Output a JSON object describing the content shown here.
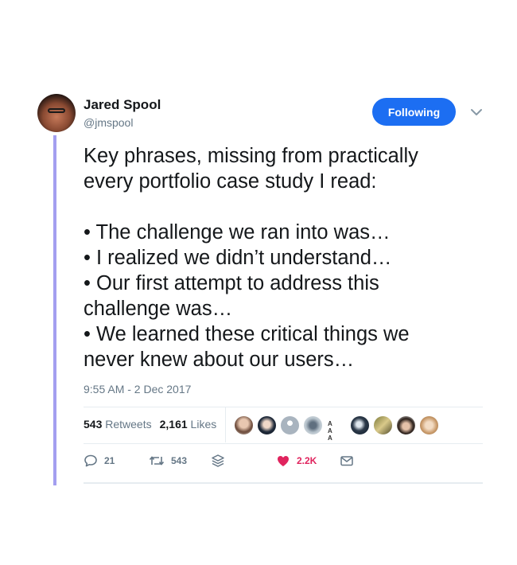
{
  "author": {
    "name": "Jared Spool",
    "handle": "@jmspool"
  },
  "follow_button": {
    "label": "Following"
  },
  "tweet": {
    "text": "Key phrases, missing from practically\nevery portfolio case study I read:\n\n• The challenge we ran into was…\n• I realized we didn’t understand…\n• Our first attempt to address this\nchallenge was…\n• We learned these critical things we\nnever knew about our users…",
    "timestamp": "9:55 AM - 2 Dec 2017"
  },
  "stats": {
    "retweets_count": "543",
    "retweets_label": "Retweets",
    "likes_count": "2,161",
    "likes_label": "Likes",
    "liker_avatar_text": "A A A"
  },
  "actions": {
    "reply_count": "21",
    "retweet_count": "543",
    "like_count": "2.2K"
  },
  "colors": {
    "accent": "#1c6ef2",
    "thread_line": "#a39ff0",
    "like": "#e0245e",
    "muted": "#657786"
  },
  "icons": [
    "chevron-down-icon",
    "reply-icon",
    "retweet-icon",
    "stack-icon",
    "heart-icon",
    "mail-icon"
  ]
}
